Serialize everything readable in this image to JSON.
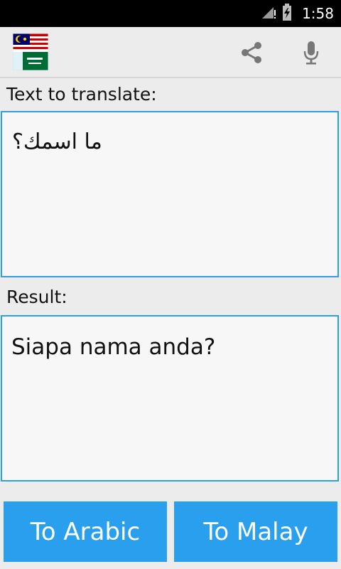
{
  "status_bar": {
    "time": "1:58"
  },
  "toolbar": {
    "share_icon": "share-icon",
    "mic_icon": "microphone-icon"
  },
  "input_section": {
    "label": "Text to translate:",
    "text": "ما اسمك؟"
  },
  "result_section": {
    "label": "Result:",
    "text": "Siapa nama anda?"
  },
  "buttons": {
    "to_arabic": "To Arabic",
    "to_malay": "To Malay"
  },
  "colors": {
    "accent": "#2a9fee",
    "border": "#2f9de8",
    "background": "#ececec"
  }
}
